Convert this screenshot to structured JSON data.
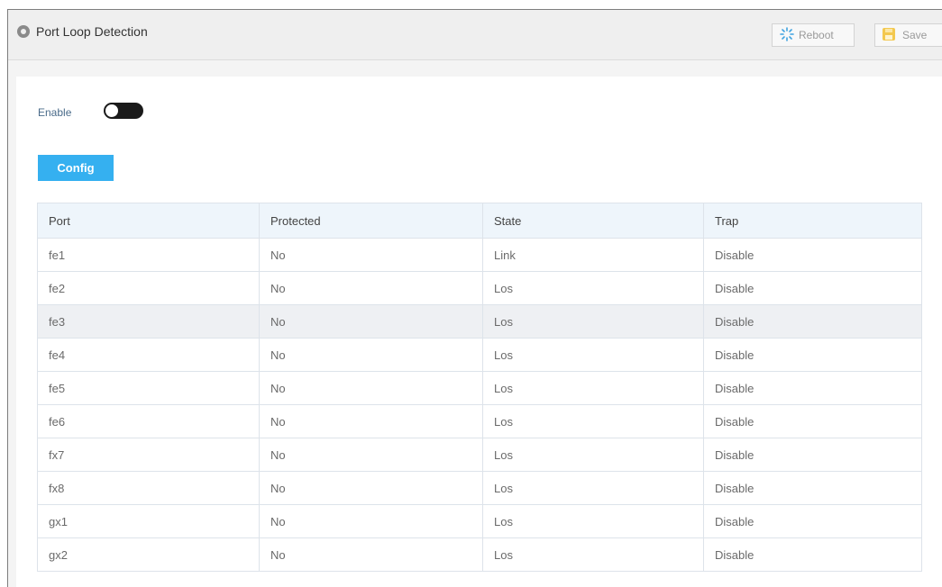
{
  "header": {
    "title": "Port Loop Detection",
    "icon": "location-pin-icon",
    "reboot_label": "Reboot",
    "save_label": "Save"
  },
  "settings": {
    "enable_label": "Enable",
    "enable_state": "off",
    "config_label": "Config"
  },
  "colors": {
    "accent": "#35b0f0",
    "toggle": "#1a1a1a",
    "table_header_bg": "#eef5fb",
    "row_highlight": "#eef0f3"
  },
  "table": {
    "columns": [
      "Port",
      "Protected",
      "State",
      "Trap"
    ],
    "highlighted_row": "fe3",
    "rows": [
      [
        "fe1",
        "No",
        "Link",
        "Disable"
      ],
      [
        "fe2",
        "No",
        "Los",
        "Disable"
      ],
      [
        "fe3",
        "No",
        "Los",
        "Disable"
      ],
      [
        "fe4",
        "No",
        "Los",
        "Disable"
      ],
      [
        "fe5",
        "No",
        "Los",
        "Disable"
      ],
      [
        "fe6",
        "No",
        "Los",
        "Disable"
      ],
      [
        "fx7",
        "No",
        "Los",
        "Disable"
      ],
      [
        "fx8",
        "No",
        "Los",
        "Disable"
      ],
      [
        "gx1",
        "No",
        "Los",
        "Disable"
      ],
      [
        "gx2",
        "No",
        "Los",
        "Disable"
      ]
    ]
  }
}
